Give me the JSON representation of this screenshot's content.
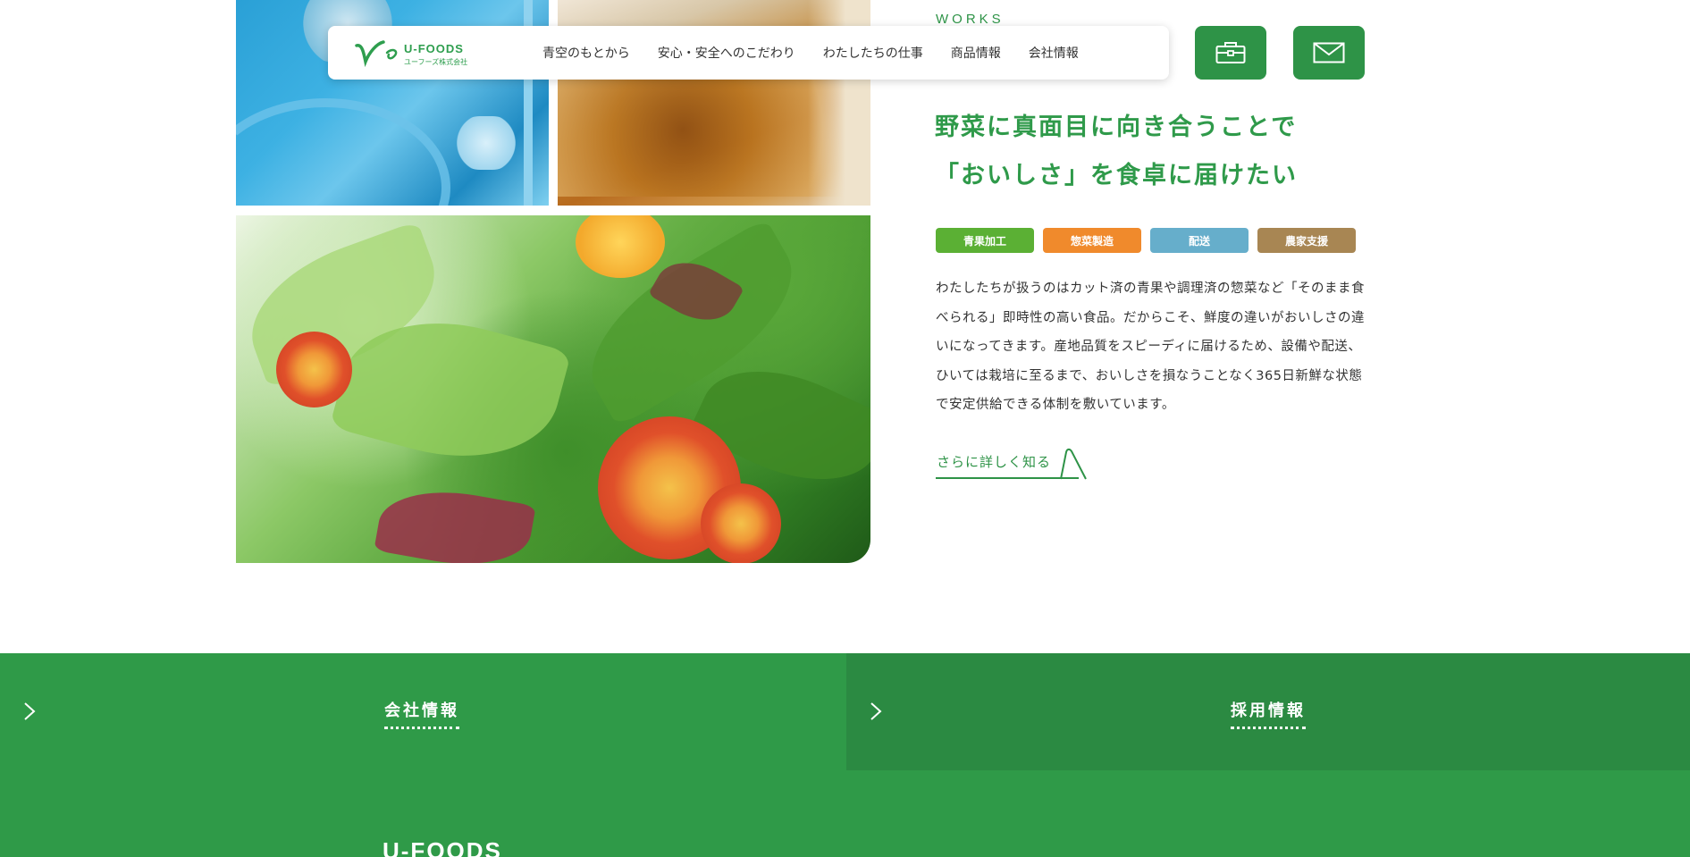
{
  "header": {
    "logo_name": "U-FOODS",
    "logo_sub": "ユーフーズ株式会社",
    "nav": [
      {
        "label": "青空のもとから"
      },
      {
        "label": "安心・安全へのこだわり"
      },
      {
        "label": "わたしたちの仕事"
      },
      {
        "label": "商品情報"
      },
      {
        "label": "会社情報"
      }
    ],
    "recruit_icon": "briefcase-icon",
    "contact_icon": "mail-icon"
  },
  "works": {
    "label": "WORKS",
    "heading_line1": "野菜に真面目に向き合うことで",
    "heading_line2": "「おいしさ」を食卓に届けたい",
    "tags": [
      {
        "label": "青果加工",
        "color": "#5bb034"
      },
      {
        "label": "惣菜製造",
        "color": "#f08a2c"
      },
      {
        "label": "配送",
        "color": "#66aecb"
      },
      {
        "label": "農家支援",
        "color": "#a88653"
      }
    ],
    "description": "わたしたちが扱うのはカット済の青果や調理済の惣菜など「そのまま食べられる」即時性の高い食品。だからこそ、鮮度の違いがおいしさの違いになってきます。産地品質をスピーディに届けるため、設備や配送、ひいては栽培に至るまで、おいしさを損なうことなく365日新鮮な状態で安定供給できる体制を敷いています。",
    "more_label": "さらに詳しく知る"
  },
  "bands": {
    "company_label": "会社情報",
    "recruit_label": "採用情報"
  },
  "footer": {
    "logo_name": "U-FOODS"
  },
  "colors": {
    "brand_green": "#2e9347",
    "band_green": "#2f9a48",
    "band_green_dark": "#2b8a42"
  }
}
